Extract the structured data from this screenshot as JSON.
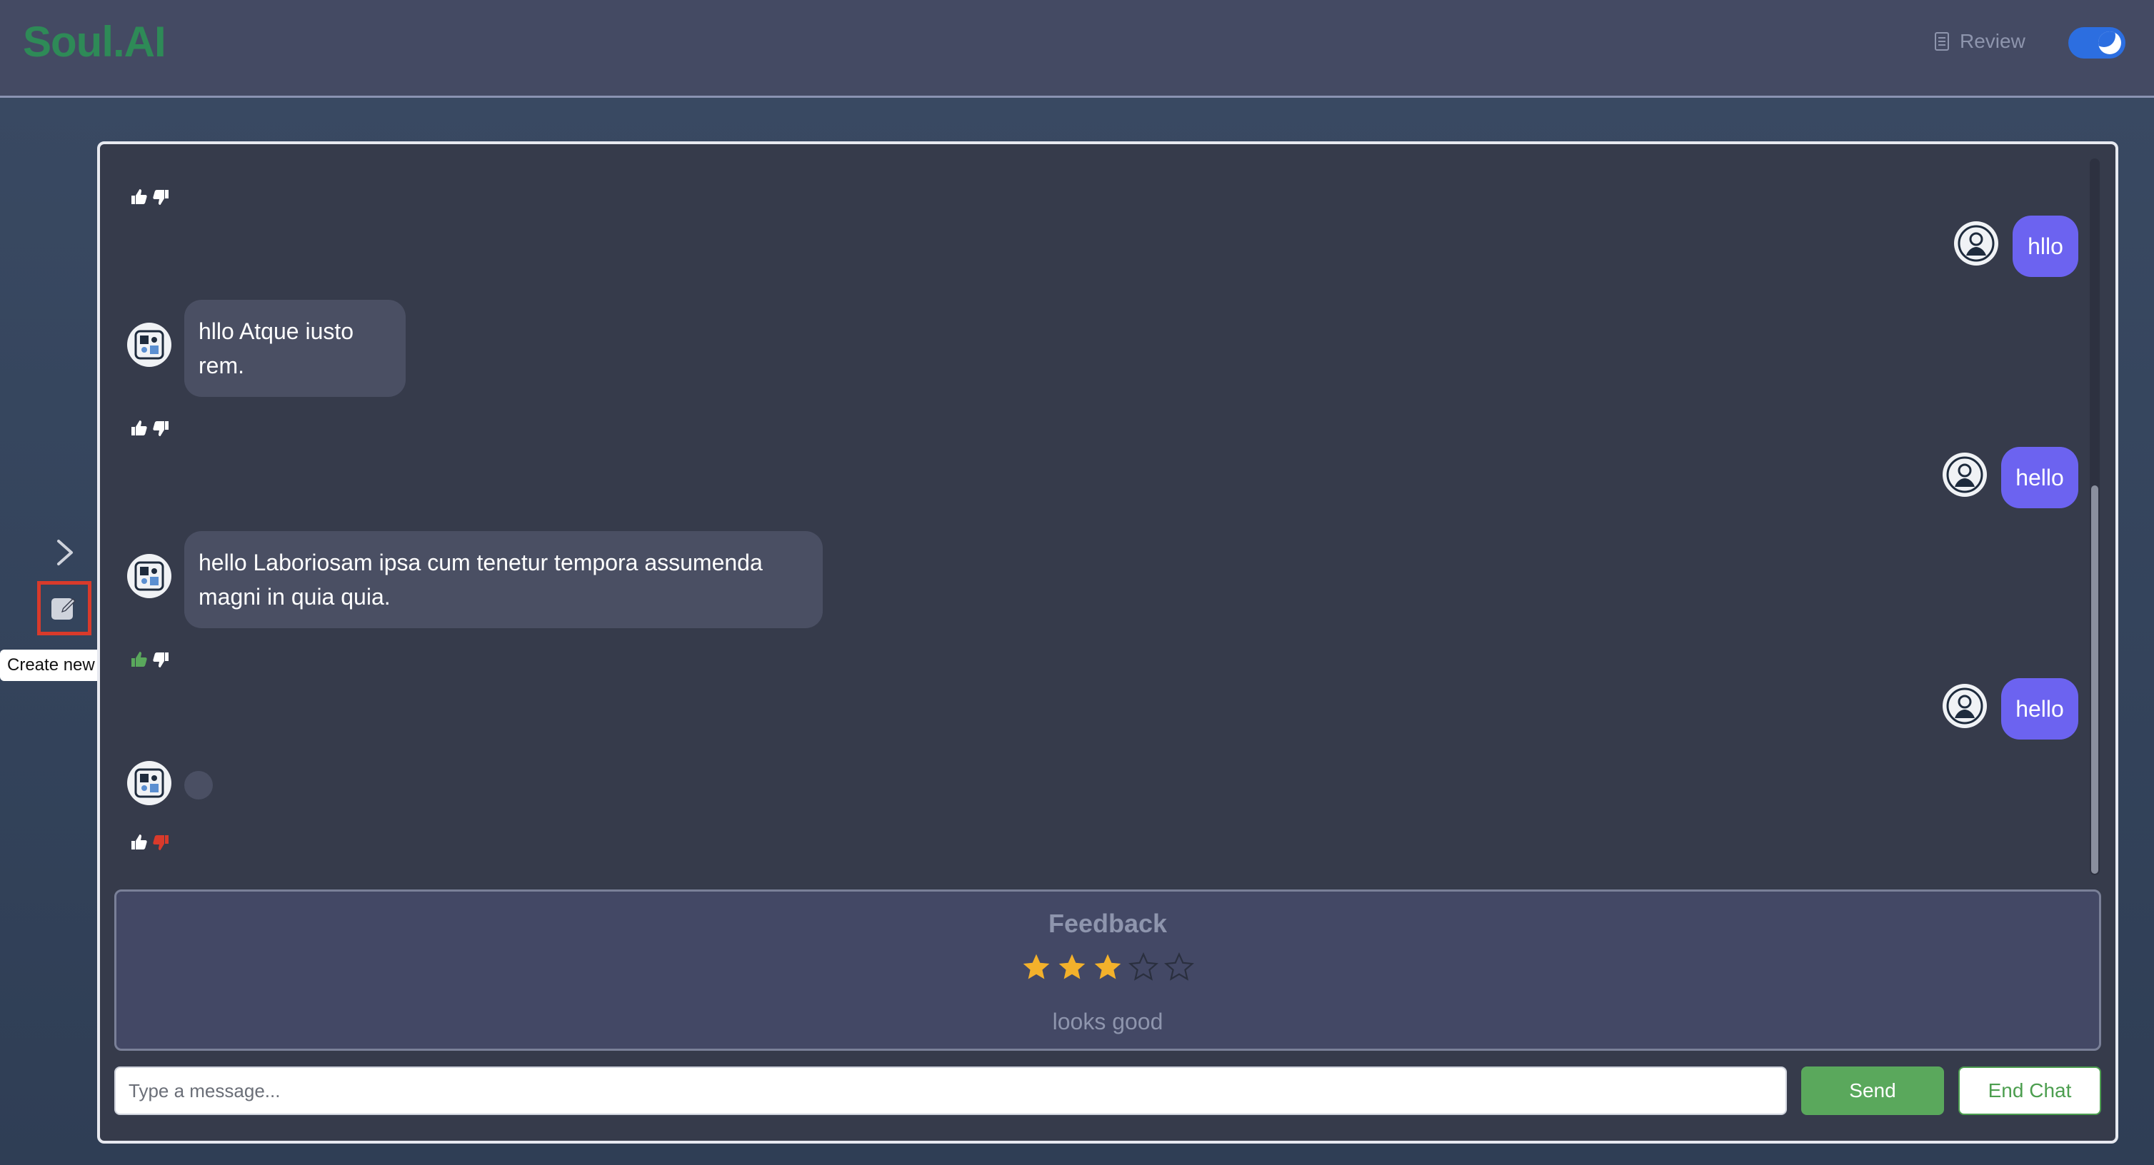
{
  "app": {
    "logo": "Soul.AI"
  },
  "header": {
    "review_label": "Review"
  },
  "sidebar": {
    "new_chat_tooltip": "Create new chat"
  },
  "chat": {
    "messages": [
      {
        "role": "user",
        "text": "hllo"
      },
      {
        "role": "bot",
        "text": "hllo Atque iusto rem."
      },
      {
        "role": "user",
        "text": "hello"
      },
      {
        "role": "bot",
        "text": "hello Laboriosam ipsa cum tenetur tempora assumenda magni in quia quia."
      },
      {
        "role": "user",
        "text": "hello"
      },
      {
        "role": "bot",
        "text": ""
      }
    ]
  },
  "feedback": {
    "title": "Feedback",
    "rating": 3,
    "max_rating": 5,
    "comment": "looks good"
  },
  "composer": {
    "placeholder": "Type a message...",
    "send_label": "Send",
    "end_label": "End Chat"
  },
  "colors": {
    "brand": "#2e8a57",
    "user_bubble": "#6c63f0",
    "bot_bubble": "#4a4f63",
    "send_button": "#5aa85c",
    "star_active": "#f3b12b",
    "thumb_down_active": "#d93a2b"
  },
  "icons": {
    "review": "document-icon",
    "theme_toggle": "moon-icon",
    "expand_sidebar": "chevron-right-icon",
    "new_chat": "edit-icon",
    "thumbs_up": "thumbs-up-icon",
    "thumbs_down": "thumbs-down-icon",
    "bot_avatar": "bot-avatar-icon",
    "user_avatar": "user-avatar-icon",
    "star": "star-icon"
  }
}
